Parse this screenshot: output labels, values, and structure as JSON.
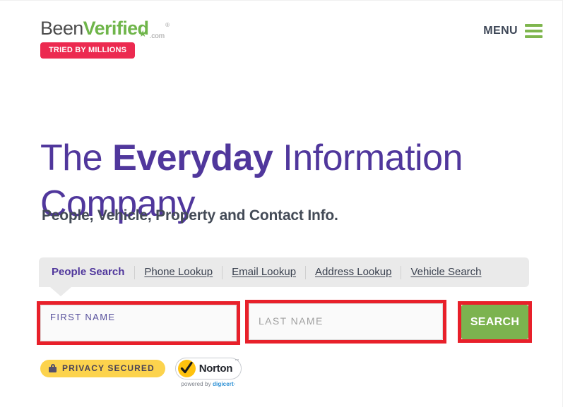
{
  "header": {
    "logo": {
      "part1": "Been",
      "part2": "Verified",
      "dotcom": ".com",
      "registered": "®",
      "star": "★"
    },
    "tried_badge": "TRIED BY MILLIONS",
    "menu_label": "MENU",
    "menu_icon": "hamburger-icon"
  },
  "hero": {
    "title_part1": "The ",
    "title_bold": "Everyday",
    "title_part2": " Information Company",
    "subtitle": "People, Vehicle, Property and Contact Info."
  },
  "tabs": [
    {
      "label": "People Search",
      "active": true
    },
    {
      "label": "Phone Lookup",
      "active": false
    },
    {
      "label": "Email Lookup",
      "active": false
    },
    {
      "label": "Address Lookup",
      "active": false
    },
    {
      "label": "Vehicle Search",
      "active": false
    }
  ],
  "search_form": {
    "first_name": {
      "label": "FIRST NAME",
      "value": ""
    },
    "last_name": {
      "label": "LAST NAME",
      "value": ""
    },
    "submit_label": "SEARCH"
  },
  "trust": {
    "privacy_label": "PRIVACY SECURED",
    "privacy_icon": "lock-icon",
    "norton_label": "Norton",
    "norton_tm": "™",
    "norton_powered_by": "powered by ",
    "norton_digicert": "digicert·"
  },
  "colors": {
    "purple": "#50379c",
    "green": "#7cb34f",
    "crimson": "#ec2a50",
    "highlight_red": "#e8202a",
    "yellow": "#fcd34d",
    "tabbar_gray": "#eaeaea",
    "slate": "#3e4757"
  }
}
